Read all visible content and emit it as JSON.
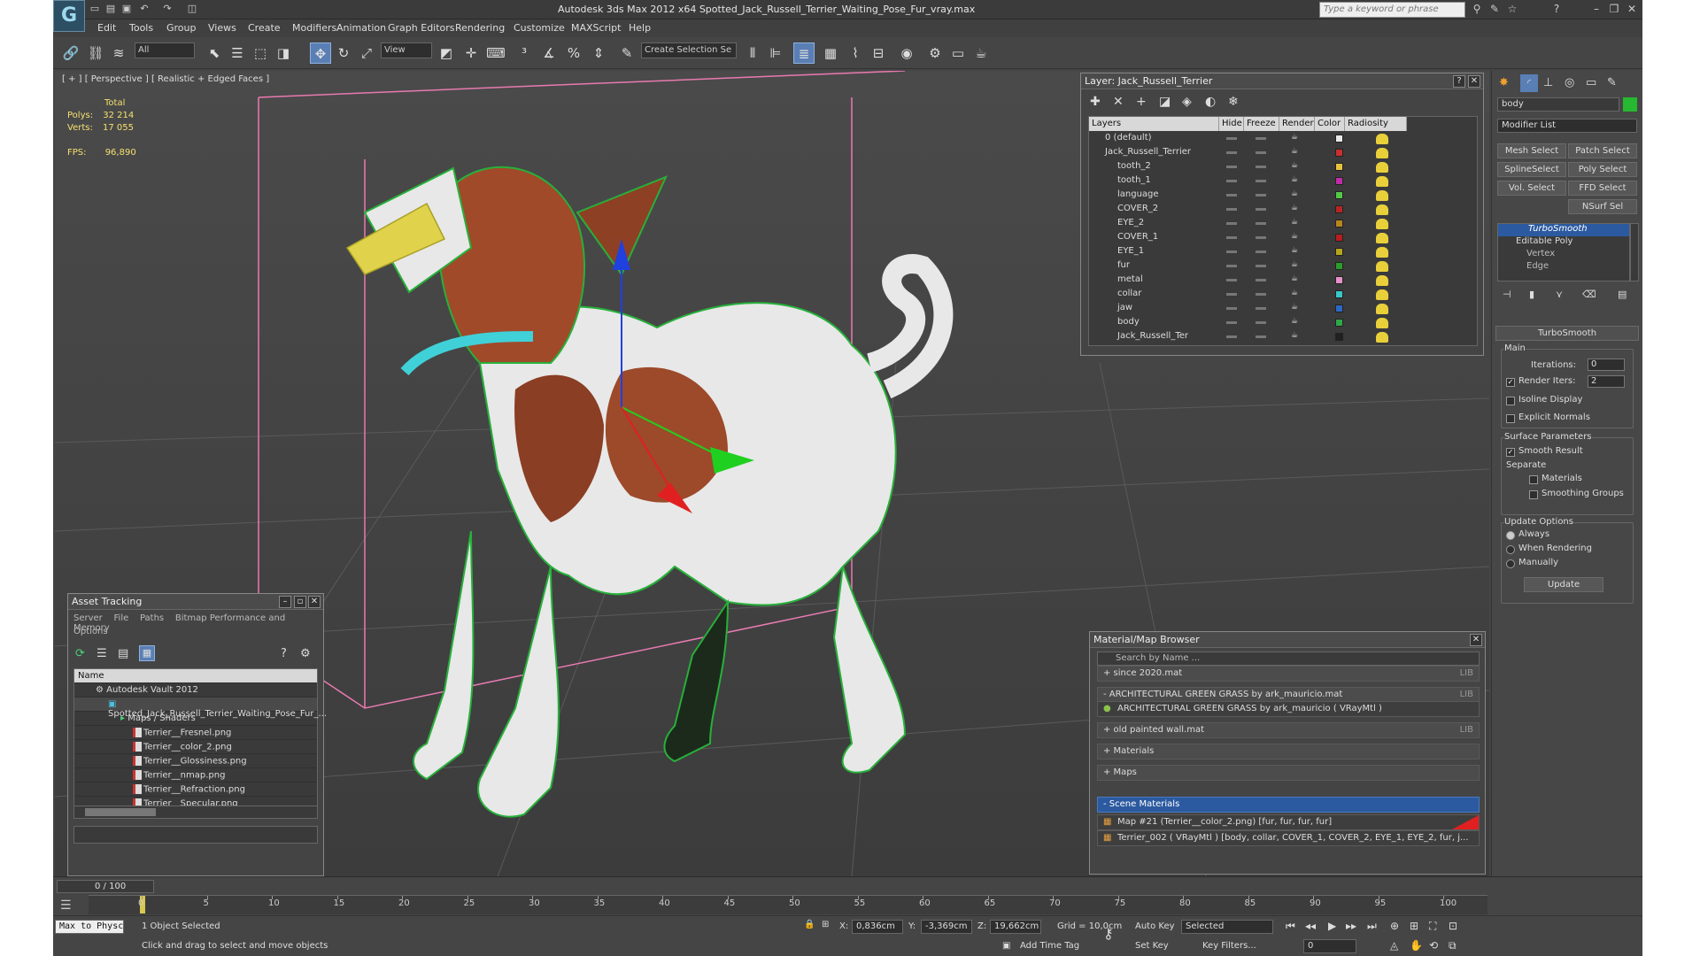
{
  "window": {
    "title": "Autodesk 3ds Max  2012 x64     Spotted_Jack_Russell_Terrier_Waiting_Pose_Fur_vray.max",
    "search_placeholder": "Type a keyword or phrase"
  },
  "menu": [
    "Edit",
    "Tools",
    "Group",
    "Views",
    "Create",
    "Modifiers",
    "Animation",
    "Graph Editors",
    "Rendering",
    "Customize",
    "MAXScript",
    "Help"
  ],
  "toolbar": {
    "filter_dropdown": "All",
    "refcoord_dropdown": "View",
    "selection_set_dropdown": "Create Selection Se"
  },
  "viewport": {
    "label": "[ + ] [ Perspective ] [ Realistic + Edged Faces ]",
    "stats_header": "Total",
    "polys_label": "Polys:",
    "polys_value": "32 214",
    "verts_label": "Verts:",
    "verts_value": "17 055",
    "fps_label": "FPS:",
    "fps_value": "96,890"
  },
  "layer_dialog": {
    "title": "Layer: Jack_Russell_Terrier",
    "columns": [
      "Layers",
      "Hide",
      "Freeze",
      "Render",
      "Color",
      "Radiosity"
    ],
    "rows": [
      {
        "name": "0 (default)",
        "color": "#e8e8e8"
      },
      {
        "name": "Jack_Russell_Terrier",
        "color": "#c83030"
      },
      {
        "name": "tooth_2",
        "color": "#e8c23a"
      },
      {
        "name": "tooth_1",
        "color": "#c02ca8"
      },
      {
        "name": "language",
        "color": "#52c848"
      },
      {
        "name": "COVER_2",
        "color": "#b82424"
      },
      {
        "name": "EYE_2",
        "color": "#b8861c"
      },
      {
        "name": "COVER_1",
        "color": "#b81c1c"
      },
      {
        "name": "EYE_1",
        "color": "#b8a41c"
      },
      {
        "name": "fur",
        "color": "#2c9c2c"
      },
      {
        "name": "metal",
        "color": "#e890c8"
      },
      {
        "name": "collar",
        "color": "#38c8c8"
      },
      {
        "name": "jaw",
        "color": "#2c68c8"
      },
      {
        "name": "body",
        "color": "#30a848"
      },
      {
        "name": "Jack_Russell_Ter",
        "color": "#202020"
      }
    ]
  },
  "asset_tracking": {
    "title": "Asset Tracking",
    "menu": [
      "Server",
      "File",
      "Paths",
      "Bitmap Performance and Memory"
    ],
    "options": "Options",
    "column": "Name",
    "vault": "Autodesk Vault 2012",
    "file": "Spotted_Jack_Russell_Terrier_Waiting_Pose_Fur_...",
    "folder": "Maps / Shaders",
    "maps": [
      "Terrier__Fresnel.png",
      "Terrier__color_2.png",
      "Terrier__Glossiness.png",
      "Terrier__nmap.png",
      "Terrier__Refraction.png",
      "Terrier__Specular.png"
    ]
  },
  "material_browser": {
    "title": "Material/Map Browser",
    "search": "Search by Name ...",
    "lib_tag": "LIB",
    "groups": [
      {
        "label": "+ since 2020.mat",
        "lib": true
      },
      {
        "label": "- ARCHITECTURAL GREEN GRASS by ark_mauricio.mat",
        "lib": true
      },
      {
        "label": "ARCHITECTURAL GREEN GRASS by ark_mauricio  ( VRayMtl )",
        "lib": false
      },
      {
        "label": "+ old painted wall.mat",
        "lib": true
      },
      {
        "label": "+ Materials",
        "lib": false
      },
      {
        "label": "+ Maps",
        "lib": false
      }
    ],
    "scene_group": "- Scene Materials",
    "scene_items": [
      "Map #21 (Terrier__color_2.png)  [fur, fur, fur, fur]",
      "Terrier_002  ( VRayMtl )  [body, collar, COVER_1, COVER_2, EYE_1, EYE_2, fur, j..."
    ]
  },
  "command_panel": {
    "object_name": "body",
    "modifier_list": "Modifier List",
    "buttons": [
      "Mesh Select",
      "Patch Select",
      "SplineSelect",
      "Poly Select",
      "Vol. Select",
      "FFD Select",
      "NSurf Sel"
    ],
    "stack": [
      "TurboSmooth",
      "Editable Poly",
      "Vertex",
      "Edge"
    ],
    "rollout_title": "TurboSmooth",
    "main_label": "Main",
    "iterations_label": "Iterations:",
    "iterations_value": "0",
    "render_iters_label": "Render Iters:",
    "render_iters_value": "2",
    "isoline": "Isoline Display",
    "explicit_normals": "Explicit Normals",
    "surface_params": "Surface Parameters",
    "smooth_result": "Smooth Result",
    "separate": "Separate",
    "materials": "Materials",
    "smoothing_groups": "Smoothing Groups",
    "update_options": "Update Options",
    "always": "Always",
    "when_rendering": "When Rendering",
    "manually": "Manually",
    "update": "Update"
  },
  "timeline": {
    "frame": "0 / 100",
    "ticks": [
      "0",
      "5",
      "10",
      "15",
      "20",
      "25",
      "30",
      "35",
      "40",
      "45",
      "50",
      "55",
      "60",
      "65",
      "70",
      "75",
      "80",
      "85",
      "90",
      "95",
      "100"
    ]
  },
  "status": {
    "script_box": "Max to Physc",
    "selected": "1 Object Selected",
    "prompt": "Click and drag to select and move objects",
    "x_label": "X:",
    "x": "0,836cm",
    "y_label": "Y:",
    "y": "-3,369cm",
    "z_label": "Z:",
    "z": "19,662cm",
    "grid": "Grid = 10,0cm",
    "add_time_tag": "Add Time Tag",
    "auto_key": "Auto Key",
    "set_key": "Set Key",
    "selected_dd": "Selected",
    "key_filters": "Key Filters...",
    "frame_field": "0"
  }
}
